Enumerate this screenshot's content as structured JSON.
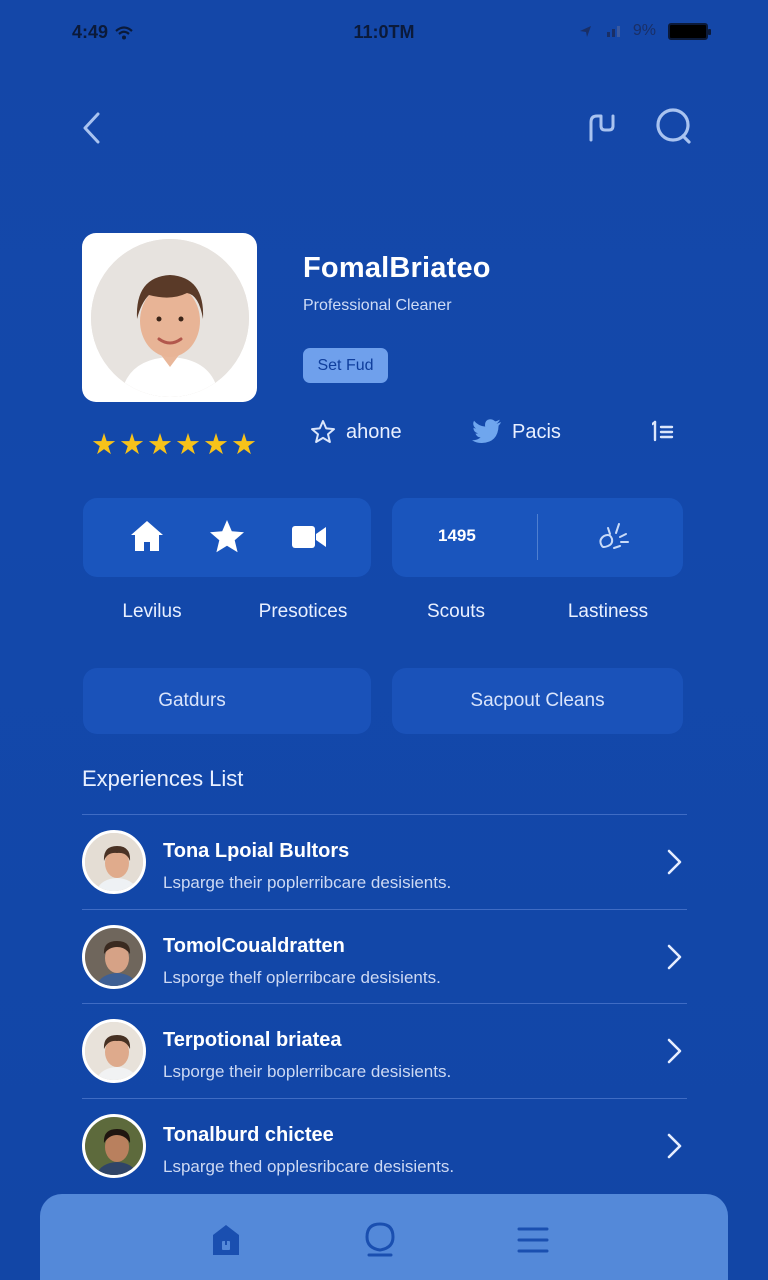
{
  "status_bar": {
    "left_time": "4:49",
    "center_time": "11:0TM",
    "battery_percent": "9%"
  },
  "profile": {
    "name": "FomalBriateo",
    "role": "Professional Cleaner",
    "badge": "Set Fud",
    "rating_stars": 6
  },
  "social": {
    "phone_label": "ahone",
    "twitter_label": "Pacis"
  },
  "stats": {
    "count": "1495"
  },
  "tabs": [
    "Levilus",
    "Presotices",
    "Scouts",
    "Lastiness"
  ],
  "pills": {
    "left": "Gatdurs",
    "right": "Sacpout Cleans"
  },
  "experiences": {
    "title": "Experiences List",
    "items": [
      {
        "title": "Tona Lpoial Bultors",
        "desc": "Lsparge their poplerribcare desisients."
      },
      {
        "title": "TomolCoualdratten",
        "desc": "Lsporge thelf oplerribcare desisients."
      },
      {
        "title": "Terpotional briatea",
        "desc": "Lsporge their boplerribcare desisients."
      },
      {
        "title": "Tonalburd chictee",
        "desc": "Lsparge thed opplesribcare desisients."
      }
    ]
  },
  "colors": {
    "background": "#1348ab",
    "card": "#1a55bd",
    "badge": "#6fa0ec",
    "star": "#f7c21a",
    "bottom_nav": "#5489d9"
  },
  "icons": {
    "top_nav": [
      "back-icon",
      "share-icon",
      "search-icon"
    ],
    "stat_left": [
      "home-icon",
      "star-icon",
      "video-icon"
    ],
    "stat_right": [
      "sparkle-icon"
    ],
    "bottom_nav": [
      "home-icon",
      "profile-icon",
      "menu-icon"
    ]
  }
}
